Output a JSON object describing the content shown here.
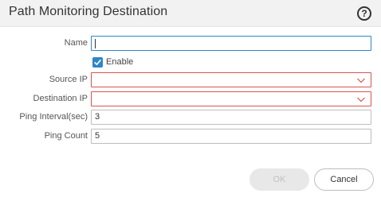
{
  "dialog": {
    "title": "Path Monitoring Destination",
    "help_icon": "?"
  },
  "form": {
    "name": {
      "label": "Name",
      "value": ""
    },
    "enable": {
      "label": "Enable",
      "checked": true
    },
    "source_ip": {
      "label": "Source IP",
      "value": ""
    },
    "destination_ip": {
      "label": "Destination IP",
      "value": ""
    },
    "ping_interval": {
      "label": "Ping Interval(sec)",
      "value": "3"
    },
    "ping_count": {
      "label": "Ping Count",
      "value": "5"
    }
  },
  "buttons": {
    "ok": "OK",
    "cancel": "Cancel"
  },
  "colors": {
    "accent": "#2f86c8",
    "error_border": "#d9534f",
    "header_bg": "#f2f2f2"
  }
}
